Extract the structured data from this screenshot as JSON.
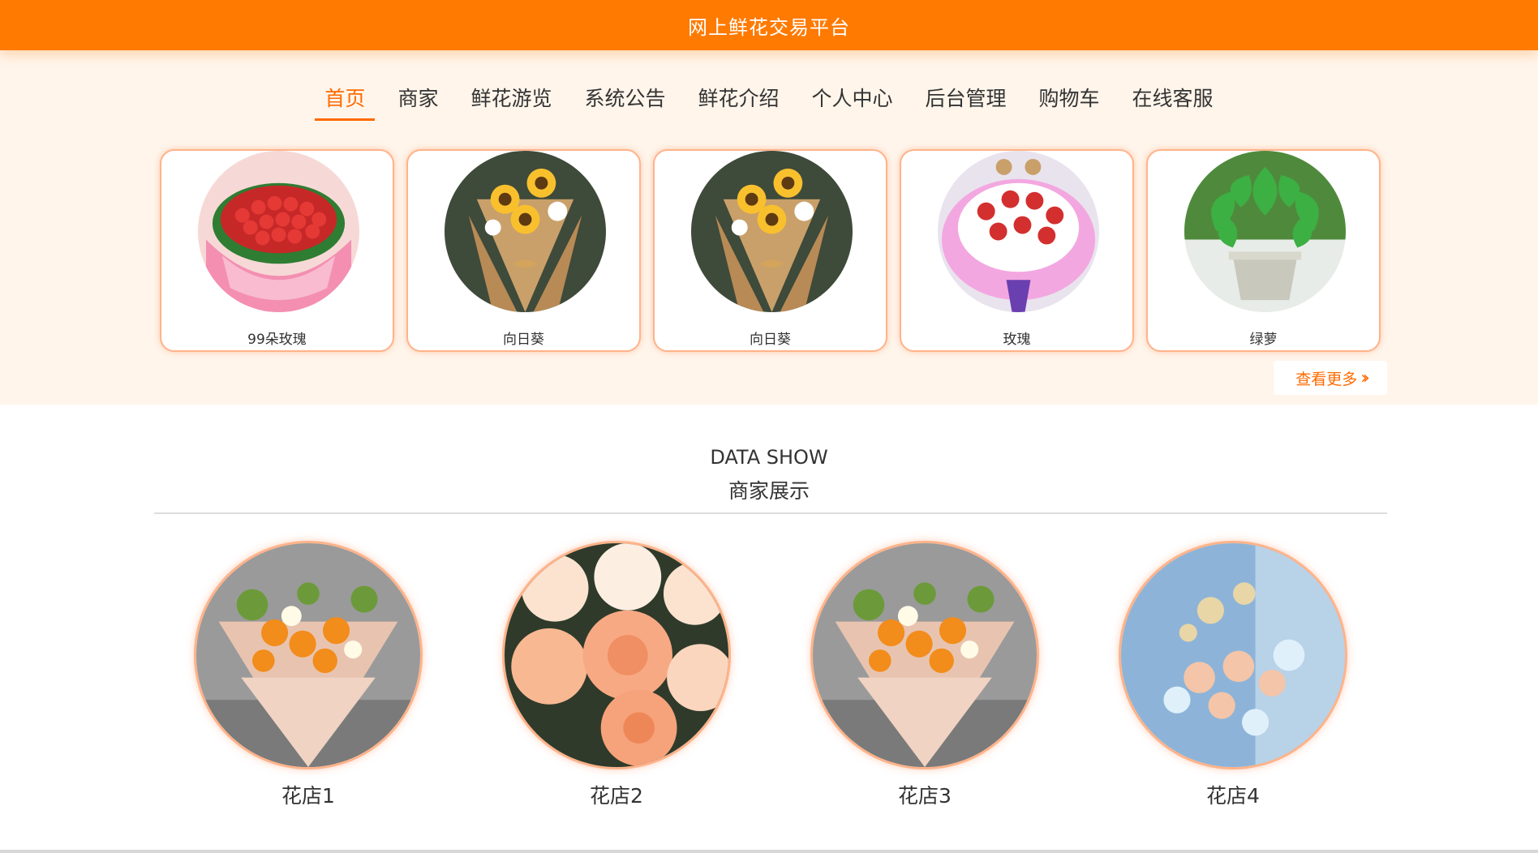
{
  "header": {
    "title": "网上鲜花交易平台"
  },
  "nav": {
    "items": [
      {
        "label": "首页",
        "active": true
      },
      {
        "label": "商家"
      },
      {
        "label": "鲜花游览"
      },
      {
        "label": "系统公告"
      },
      {
        "label": "鲜花介绍"
      },
      {
        "label": "个人中心"
      },
      {
        "label": "后台管理"
      },
      {
        "label": "购物车"
      },
      {
        "label": "在线客服"
      }
    ]
  },
  "products": {
    "items": [
      {
        "name": "99朵玫瑰",
        "image": "red-rose-bouquet"
      },
      {
        "name": "向日葵",
        "image": "sunflower-bouquet"
      },
      {
        "name": "向日葵",
        "image": "sunflower-bouquet"
      },
      {
        "name": "玫瑰",
        "image": "rose-bouquet-pink-wrap"
      },
      {
        "name": "绿萝",
        "image": "green-pothos-plant"
      }
    ],
    "more_label": "查看更多",
    "more_icon": "double-chevron-right-icon"
  },
  "merchants": {
    "title_en": "DATA SHOW",
    "title_cn": "商家展示",
    "items": [
      {
        "name": "花店1",
        "image": "orange-bouquet-gray"
      },
      {
        "name": "花店2",
        "image": "peach-roses"
      },
      {
        "name": "花店3",
        "image": "orange-bouquet-gray"
      },
      {
        "name": "花店4",
        "image": "pastel-arrangement-blue"
      }
    ]
  },
  "colors": {
    "brand": "#ff7a00",
    "accent": "#ff6a00",
    "upper_bg": "#fff5eb",
    "card_border": "#ffb38a"
  }
}
